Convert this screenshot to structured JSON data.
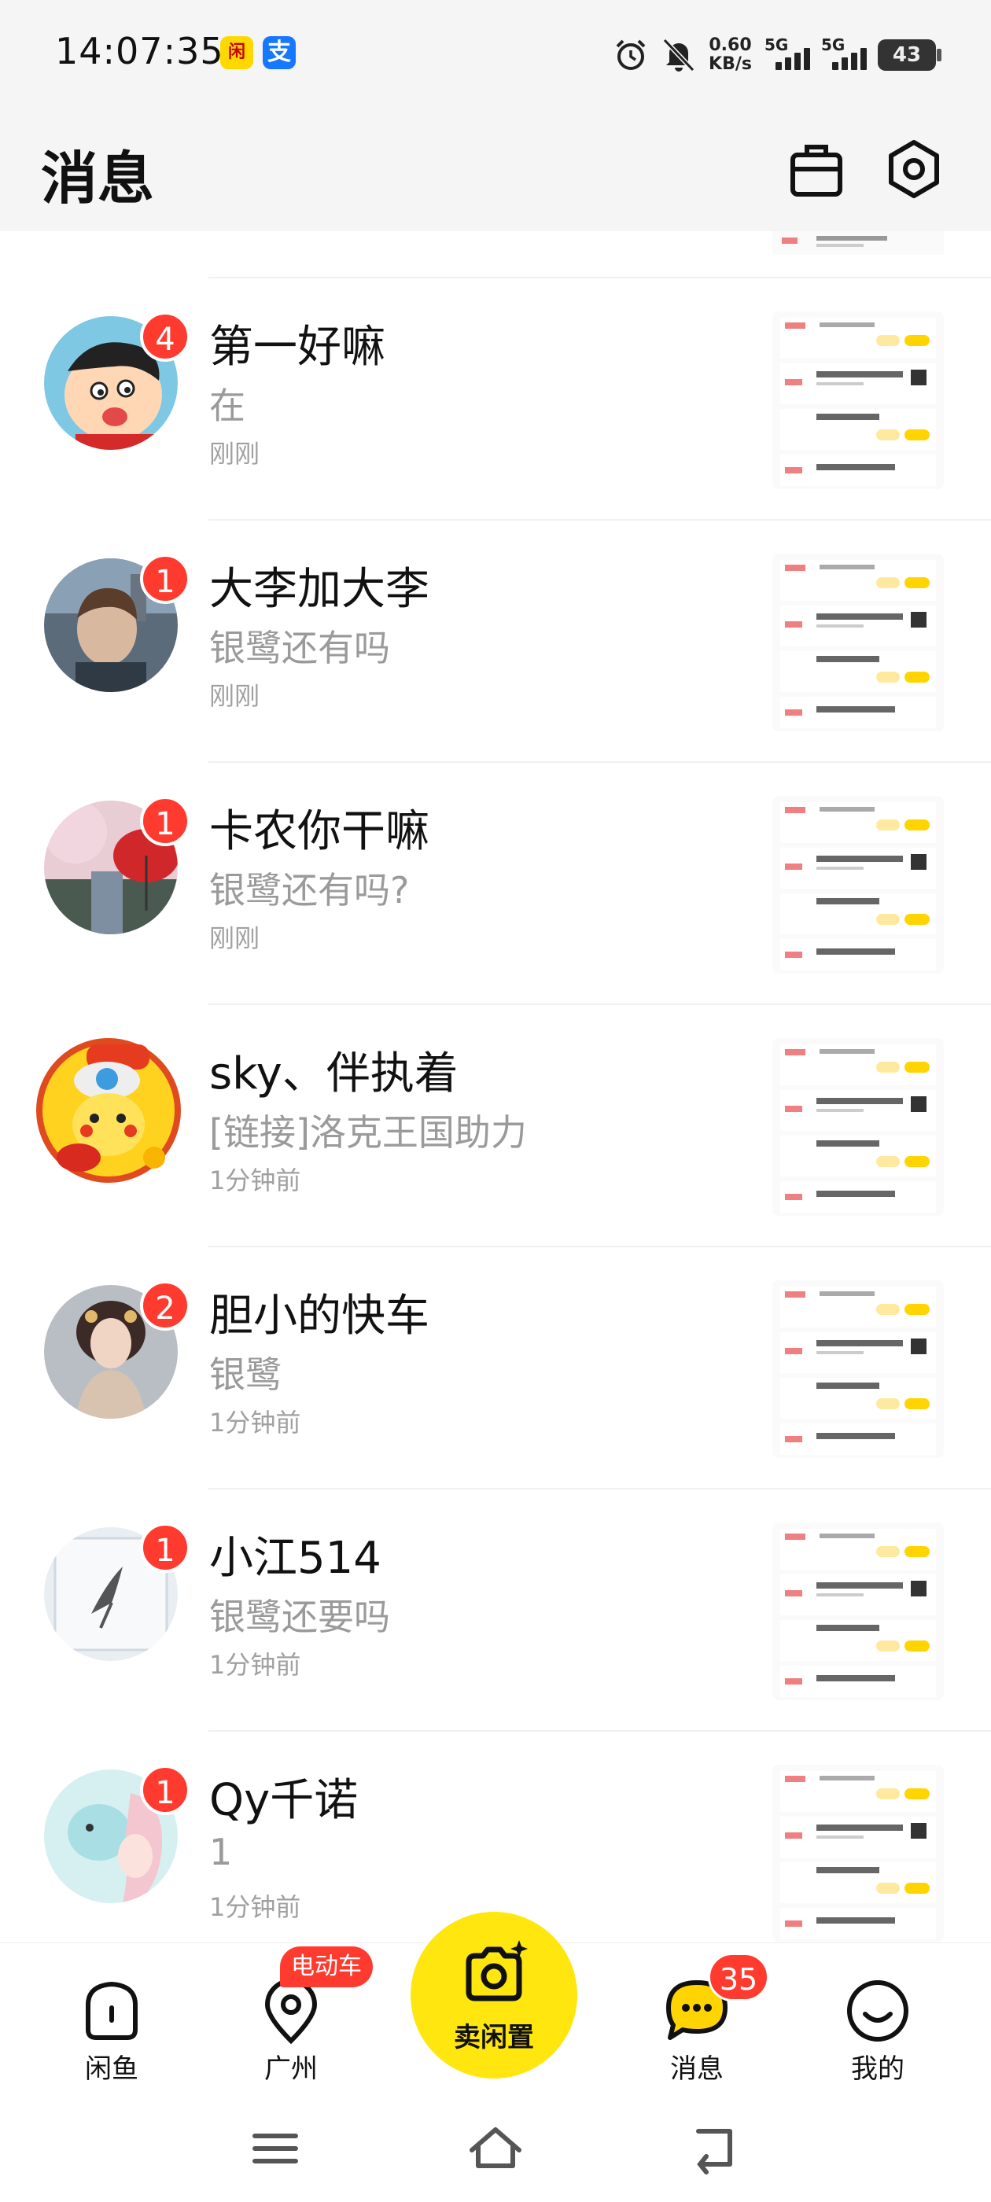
{
  "status_bar": {
    "time": "14:07:35",
    "app_icon_1": "闲",
    "app_icon_2": "支",
    "net_speed_value": "0.60",
    "net_speed_unit": "KB/s",
    "signal_1_label": "5G",
    "signal_2_label": "5G",
    "battery": "43"
  },
  "header": {
    "title": "消息"
  },
  "conversations": [
    {
      "name": "第一好嘛",
      "preview": "在",
      "time": "刚刚",
      "unread": "4"
    },
    {
      "name": "大李加大李",
      "preview": "银鹭还有吗",
      "time": "刚刚",
      "unread": "1"
    },
    {
      "name": "卡农你干嘛",
      "preview": "银鹭还有吗?",
      "time": "刚刚",
      "unread": "1"
    },
    {
      "name": "sky、伴执着",
      "preview": "[链接]洛克王国助力",
      "time": "1分钟前",
      "unread": ""
    },
    {
      "name": "胆小的快车",
      "preview": "银鹭",
      "time": "1分钟前",
      "unread": "2"
    },
    {
      "name": "小江514",
      "preview": "银鹭还要吗",
      "time": "1分钟前",
      "unread": "1"
    },
    {
      "name": "Qy千诺",
      "preview": "1",
      "time": "1分钟前",
      "unread": "1"
    }
  ],
  "bottom_nav": {
    "home_label": "闲鱼",
    "location_label": "广州",
    "location_tag": "电动车",
    "sell_label": "卖闲置",
    "messages_label": "消息",
    "messages_count": "35",
    "mine_label": "我的"
  },
  "colors": {
    "accent_yellow": "#ffe60f",
    "badge_red": "#ff3b30",
    "header_bg": "#f5f5f5"
  }
}
